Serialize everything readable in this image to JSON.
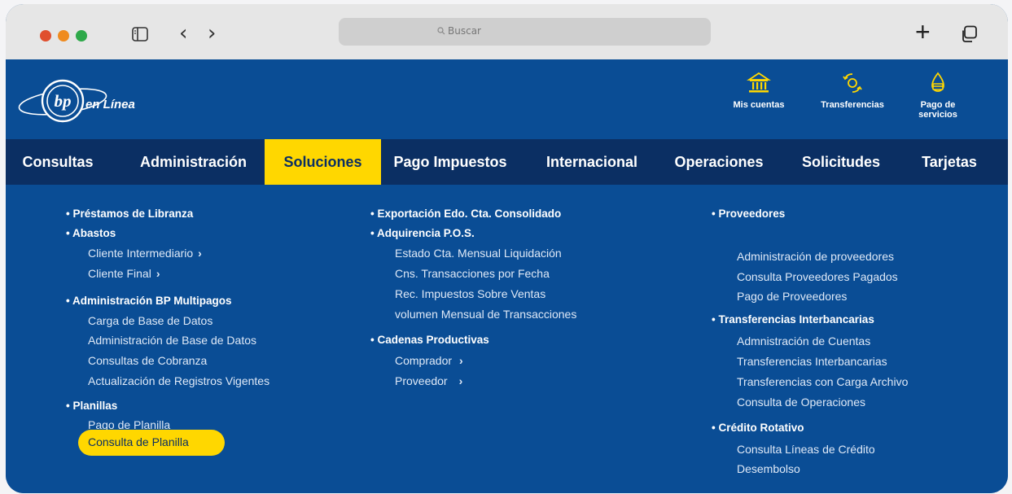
{
  "browser": {
    "search_placeholder": "Buscar"
  },
  "brand": {
    "logo_text": "bp",
    "tagline": "en Línea"
  },
  "quick_links": [
    {
      "label": "Mis cuentas",
      "icon": "bank-icon"
    },
    {
      "label": "Transferencias",
      "icon": "transfer-icon"
    },
    {
      "label": "Pago de servicios",
      "icon": "service-payment-icon"
    }
  ],
  "nav": {
    "items": [
      "Consultas",
      "Administración",
      "Soluciones",
      "Pago Impuestos",
      "Internacional",
      "Operaciones",
      "Solicitudes",
      "Tarjetas"
    ],
    "active": "Soluciones"
  },
  "menu": {
    "col1": {
      "prestamos": "• Préstamos de Libranza",
      "abastos": "• Abastos",
      "abastos_items": [
        "Cliente Intermediario",
        "Cliente Final"
      ],
      "multipagos": "• Administración BP Multipagos",
      "multipagos_items": [
        "Carga de Base de Datos",
        "Administración de Base de Datos",
        "Consultas de Cobranza",
        "Actualización de Registros Vigentes"
      ],
      "planillas": "• Planillas",
      "planillas_items": [
        "Pago de Planilla",
        "Consulta de Planilla"
      ]
    },
    "col2": {
      "exportacion": "• Exportación  Edo. Cta. Consolidado",
      "adquirencia": "• Adquirencia P.O.S.",
      "adquirencia_items": [
        "Estado Cta. Mensual Liquidación",
        "Cns. Transacciones por Fecha",
        "Rec. Impuestos Sobre Ventas",
        "volumen Mensual de Transacciones"
      ],
      "cadenas": "• Cadenas Productivas",
      "cadenas_items": [
        "Comprador",
        "Proveedor"
      ]
    },
    "col3": {
      "proveedores": "• Proveedores",
      "proveedores_items": [
        "Administración de proveedores",
        "Consulta Proveedores Pagados",
        "Pago de Proveedores"
      ],
      "transferencias": "• Transferencias Interbancarias",
      "transferencias_items": [
        "Admnistración de Cuentas",
        "Transferencias Interbancarias",
        "Transferencias con Carga Archivo",
        "Consulta de Operaciones"
      ],
      "credito": "• Crédito Rotativo",
      "credito_items": [
        "Consulta Líneas de Crédito",
        "Desembolso"
      ]
    }
  },
  "colors": {
    "primary_blue": "#0a4d95",
    "nav_dark_blue": "#0b2f63",
    "accent_yellow": "#ffd700"
  },
  "chevron": "›"
}
